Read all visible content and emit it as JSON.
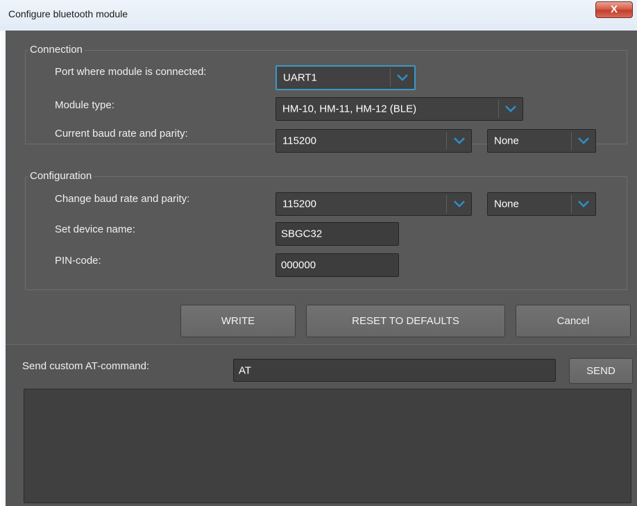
{
  "window": {
    "title": "Configure bluetooth module",
    "close_label": "X"
  },
  "connection": {
    "legend": "Connection",
    "port_label": "Port where module is connected:",
    "port_value": "UART1",
    "module_type_label": "Module type:",
    "module_type_value": "HM-10, HM-11, HM-12 (BLE)",
    "current_baud_label": "Current baud rate and parity:",
    "current_baud_value": "115200",
    "current_parity_value": "None"
  },
  "configuration": {
    "legend": "Configuration",
    "change_baud_label": "Change baud rate and parity:",
    "change_baud_value": "115200",
    "change_parity_value": "None",
    "device_name_label": "Set device name:",
    "device_name_value": "SBGC32",
    "pin_label": "PIN-code:",
    "pin_value": "000000"
  },
  "buttons": {
    "write": "WRITE",
    "reset": "RESET TO DEFAULTS",
    "cancel": "Cancel"
  },
  "custom_at": {
    "label": "Send custom AT-command:",
    "value": "AT",
    "send": "SEND"
  },
  "colors": {
    "accent": "#3c98c9",
    "background": "#595959"
  },
  "icons": {
    "dropdown": "chevron-down-icon"
  }
}
